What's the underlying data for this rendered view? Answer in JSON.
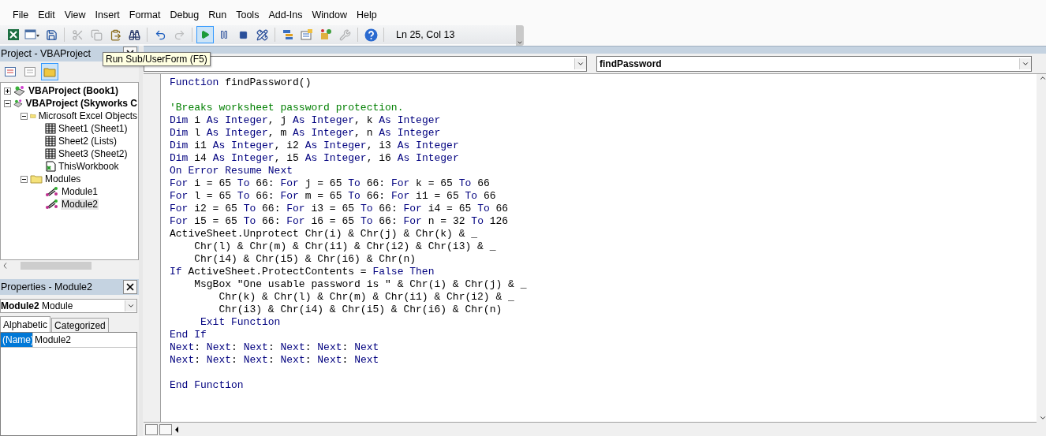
{
  "menu": [
    {
      "label": "File"
    },
    {
      "label": "Edit"
    },
    {
      "label": "View"
    },
    {
      "label": "Insert"
    },
    {
      "label": "Format"
    },
    {
      "label": "Debug"
    },
    {
      "label": "Run"
    },
    {
      "label": "Tools"
    },
    {
      "label": "Add-Ins"
    },
    {
      "label": "Window"
    },
    {
      "label": "Help"
    }
  ],
  "toolbar": {
    "buttons": [
      {
        "kind": "excel",
        "selected": false,
        "disabled": false
      },
      {
        "kind": "userform",
        "selected": false,
        "disabled": false
      },
      {
        "kind": "save",
        "selected": false,
        "disabled": false
      },
      {
        "kind": "cut",
        "selected": false,
        "disabled": true
      },
      {
        "kind": "copy",
        "selected": false,
        "disabled": true
      },
      {
        "kind": "paste",
        "selected": false,
        "disabled": false
      },
      {
        "kind": "find",
        "selected": false,
        "disabled": false
      },
      {
        "kind": "undo",
        "selected": false,
        "disabled": false
      },
      {
        "kind": "redo",
        "selected": false,
        "disabled": true
      },
      {
        "kind": "run",
        "selected": true,
        "disabled": false
      },
      {
        "kind": "pause",
        "selected": false,
        "disabled": false
      },
      {
        "kind": "stop",
        "selected": false,
        "disabled": false
      },
      {
        "kind": "design",
        "selected": false,
        "disabled": false
      },
      {
        "kind": "explorer",
        "selected": false,
        "disabled": false
      },
      {
        "kind": "properties",
        "selected": false,
        "disabled": false
      },
      {
        "kind": "browser",
        "selected": false,
        "disabled": false
      },
      {
        "kind": "toolbox",
        "selected": false,
        "disabled": true
      },
      {
        "kind": "help",
        "selected": false,
        "disabled": false
      }
    ],
    "status": "Ln 25, Col 13"
  },
  "tooltip": "Run Sub/UserForm (F5)",
  "project": {
    "title": "Project - VBAProject",
    "view_buttons": [
      {
        "kind": "code",
        "selected": false
      },
      {
        "kind": "object",
        "selected": false
      },
      {
        "kind": "folders",
        "selected": true
      }
    ],
    "tree": [
      {
        "label": "VBAProject (Book1)",
        "kind": "project",
        "expanded": false,
        "selected": false
      },
      {
        "label": "VBAProject (Skyworks C",
        "kind": "project",
        "expanded": true,
        "selected": false,
        "children": [
          {
            "label": "Microsoft Excel Objects",
            "kind": "folder",
            "expanded": true,
            "selected": false,
            "children": [
              {
                "label": "Sheet1 (Sheet1)",
                "kind": "sheet",
                "selected": false
              },
              {
                "label": "Sheet2 (Lists)",
                "kind": "sheet",
                "selected": false
              },
              {
                "label": "Sheet3 (Sheet2)",
                "kind": "sheet",
                "selected": false
              },
              {
                "label": "ThisWorkbook",
                "kind": "workbook",
                "selected": false
              }
            ]
          },
          {
            "label": "Modules",
            "kind": "folder",
            "expanded": true,
            "selected": false,
            "children": [
              {
                "label": "Module1",
                "kind": "module",
                "selected": false
              },
              {
                "label": "Module2",
                "kind": "module",
                "selected": true
              }
            ]
          }
        ]
      }
    ]
  },
  "properties": {
    "title": "Properties - Module2",
    "object": {
      "name": "Module2",
      "type": "Module"
    },
    "tabs": [
      {
        "label": "Alphabetic",
        "selected": true
      },
      {
        "label": "Categorized",
        "selected": false
      }
    ],
    "rows": [
      {
        "name": "(Name)",
        "value": "Module2",
        "selected": true
      }
    ]
  },
  "code_window": {
    "procedure": "findPassword",
    "lines": [
      {
        "kind": "code",
        "segments": [
          {
            "kind": "keyword",
            "text": "Function"
          },
          {
            "kind": "plain",
            "text": " findPassword()"
          }
        ]
      },
      {
        "kind": "blank"
      },
      {
        "kind": "code",
        "segments": [
          {
            "kind": "comment",
            "text": "'Breaks worksheet password protection."
          }
        ]
      },
      {
        "kind": "code",
        "segments": [
          {
            "kind": "keyword",
            "text": "Dim"
          },
          {
            "kind": "plain",
            "text": " i "
          },
          {
            "kind": "keyword",
            "text": "As Integer"
          },
          {
            "kind": "plain",
            "text": ", j "
          },
          {
            "kind": "keyword",
            "text": "As Integer"
          },
          {
            "kind": "plain",
            "text": ", k "
          },
          {
            "kind": "keyword",
            "text": "As Integer"
          }
        ]
      },
      {
        "kind": "code",
        "segments": [
          {
            "kind": "keyword",
            "text": "Dim"
          },
          {
            "kind": "plain",
            "text": " l "
          },
          {
            "kind": "keyword",
            "text": "As Integer"
          },
          {
            "kind": "plain",
            "text": ", m "
          },
          {
            "kind": "keyword",
            "text": "As Integer"
          },
          {
            "kind": "plain",
            "text": ", n "
          },
          {
            "kind": "keyword",
            "text": "As Integer"
          }
        ]
      },
      {
        "kind": "code",
        "segments": [
          {
            "kind": "keyword",
            "text": "Dim"
          },
          {
            "kind": "plain",
            "text": " i1 "
          },
          {
            "kind": "keyword",
            "text": "As Integer"
          },
          {
            "kind": "plain",
            "text": ", i2 "
          },
          {
            "kind": "keyword",
            "text": "As Integer"
          },
          {
            "kind": "plain",
            "text": ", i3 "
          },
          {
            "kind": "keyword",
            "text": "As Integer"
          }
        ]
      },
      {
        "kind": "code",
        "segments": [
          {
            "kind": "keyword",
            "text": "Dim"
          },
          {
            "kind": "plain",
            "text": " i4 "
          },
          {
            "kind": "keyword",
            "text": "As Integer"
          },
          {
            "kind": "plain",
            "text": ", i5 "
          },
          {
            "kind": "keyword",
            "text": "As Integer"
          },
          {
            "kind": "plain",
            "text": ", i6 "
          },
          {
            "kind": "keyword",
            "text": "As Integer"
          }
        ]
      },
      {
        "kind": "code",
        "segments": [
          {
            "kind": "keyword",
            "text": "On Error Resume Next"
          }
        ]
      },
      {
        "kind": "code",
        "segments": [
          {
            "kind": "keyword",
            "text": "For"
          },
          {
            "kind": "plain",
            "text": " i = 65 "
          },
          {
            "kind": "keyword",
            "text": "To"
          },
          {
            "kind": "plain",
            "text": " 66: "
          },
          {
            "kind": "keyword",
            "text": "For"
          },
          {
            "kind": "plain",
            "text": " j = 65 "
          },
          {
            "kind": "keyword",
            "text": "To"
          },
          {
            "kind": "plain",
            "text": " 66: "
          },
          {
            "kind": "keyword",
            "text": "For"
          },
          {
            "kind": "plain",
            "text": " k = 65 "
          },
          {
            "kind": "keyword",
            "text": "To"
          },
          {
            "kind": "plain",
            "text": " 66"
          }
        ]
      },
      {
        "kind": "code",
        "segments": [
          {
            "kind": "keyword",
            "text": "For"
          },
          {
            "kind": "plain",
            "text": " l = 65 "
          },
          {
            "kind": "keyword",
            "text": "To"
          },
          {
            "kind": "plain",
            "text": " 66: "
          },
          {
            "kind": "keyword",
            "text": "For"
          },
          {
            "kind": "plain",
            "text": " m = 65 "
          },
          {
            "kind": "keyword",
            "text": "To"
          },
          {
            "kind": "plain",
            "text": " 66: "
          },
          {
            "kind": "keyword",
            "text": "For"
          },
          {
            "kind": "plain",
            "text": " i1 = 65 "
          },
          {
            "kind": "keyword",
            "text": "To"
          },
          {
            "kind": "plain",
            "text": " 66"
          }
        ]
      },
      {
        "kind": "code",
        "segments": [
          {
            "kind": "keyword",
            "text": "For"
          },
          {
            "kind": "plain",
            "text": " i2 = 65 "
          },
          {
            "kind": "keyword",
            "text": "To"
          },
          {
            "kind": "plain",
            "text": " 66: "
          },
          {
            "kind": "keyword",
            "text": "For"
          },
          {
            "kind": "plain",
            "text": " i3 = 65 "
          },
          {
            "kind": "keyword",
            "text": "To"
          },
          {
            "kind": "plain",
            "text": " 66: "
          },
          {
            "kind": "keyword",
            "text": "For"
          },
          {
            "kind": "plain",
            "text": " i4 = 65 "
          },
          {
            "kind": "keyword",
            "text": "To"
          },
          {
            "kind": "plain",
            "text": " 66"
          }
        ]
      },
      {
        "kind": "code",
        "segments": [
          {
            "kind": "keyword",
            "text": "For"
          },
          {
            "kind": "plain",
            "text": " i5 = 65 "
          },
          {
            "kind": "keyword",
            "text": "To"
          },
          {
            "kind": "plain",
            "text": " 66: "
          },
          {
            "kind": "keyword",
            "text": "For"
          },
          {
            "kind": "plain",
            "text": " i6 = 65 "
          },
          {
            "kind": "keyword",
            "text": "To"
          },
          {
            "kind": "plain",
            "text": " 66: "
          },
          {
            "kind": "keyword",
            "text": "For"
          },
          {
            "kind": "plain",
            "text": " n = 32 "
          },
          {
            "kind": "keyword",
            "text": "To"
          },
          {
            "kind": "plain",
            "text": " 126"
          }
        ]
      },
      {
        "kind": "code",
        "segments": [
          {
            "kind": "plain",
            "text": "ActiveSheet.Unprotect Chr(i) & Chr(j) & Chr(k) & _"
          }
        ]
      },
      {
        "kind": "code",
        "segments": [
          {
            "kind": "plain",
            "text": "    Chr(l) & Chr(m) & Chr(i1) & Chr(i2) & Chr(i3) & _"
          }
        ]
      },
      {
        "kind": "code",
        "segments": [
          {
            "kind": "plain",
            "text": "    Chr(i4) & Chr(i5) & Chr(i6) & Chr(n)"
          }
        ]
      },
      {
        "kind": "code",
        "segments": [
          {
            "kind": "keyword",
            "text": "If"
          },
          {
            "kind": "plain",
            "text": " ActiveSheet.ProtectContents = "
          },
          {
            "kind": "keyword",
            "text": "False Then"
          }
        ]
      },
      {
        "kind": "code",
        "segments": [
          {
            "kind": "plain",
            "text": "    MsgBox \"One usable password is \" & Chr(i) & Chr(j) & _"
          }
        ]
      },
      {
        "kind": "code",
        "segments": [
          {
            "kind": "plain",
            "text": "        Chr(k) & Chr(l) & Chr(m) & Chr(i1) & Chr(i2) & _"
          }
        ]
      },
      {
        "kind": "code",
        "segments": [
          {
            "kind": "plain",
            "text": "        Chr(i3) & Chr(i4) & Chr(i5) & Chr(i6) & Chr(n)"
          }
        ]
      },
      {
        "kind": "code",
        "segments": [
          {
            "kind": "keyword",
            "text": "     Exit Function"
          }
        ]
      },
      {
        "kind": "code",
        "segments": [
          {
            "kind": "keyword",
            "text": "End If"
          }
        ]
      },
      {
        "kind": "code",
        "segments": [
          {
            "kind": "keyword",
            "text": "Next"
          },
          {
            "kind": "plain",
            "text": ": "
          },
          {
            "kind": "keyword",
            "text": "Next"
          },
          {
            "kind": "plain",
            "text": ": "
          },
          {
            "kind": "keyword",
            "text": "Next"
          },
          {
            "kind": "plain",
            "text": ": "
          },
          {
            "kind": "keyword",
            "text": "Next"
          },
          {
            "kind": "plain",
            "text": ": "
          },
          {
            "kind": "keyword",
            "text": "Next"
          },
          {
            "kind": "plain",
            "text": ": "
          },
          {
            "kind": "keyword",
            "text": "Next"
          }
        ]
      },
      {
        "kind": "code",
        "segments": [
          {
            "kind": "keyword",
            "text": "Next"
          },
          {
            "kind": "plain",
            "text": ": "
          },
          {
            "kind": "keyword",
            "text": "Next"
          },
          {
            "kind": "plain",
            "text": ": "
          },
          {
            "kind": "keyword",
            "text": "Next"
          },
          {
            "kind": "plain",
            "text": ": "
          },
          {
            "kind": "keyword",
            "text": "Next"
          },
          {
            "kind": "plain",
            "text": ": "
          },
          {
            "kind": "keyword",
            "text": "Next"
          },
          {
            "kind": "plain",
            "text": ": "
          },
          {
            "kind": "keyword",
            "text": "Next"
          }
        ]
      },
      {
        "kind": "blank"
      },
      {
        "kind": "code",
        "segments": [
          {
            "kind": "keyword",
            "text": "End Function"
          }
        ]
      }
    ]
  }
}
